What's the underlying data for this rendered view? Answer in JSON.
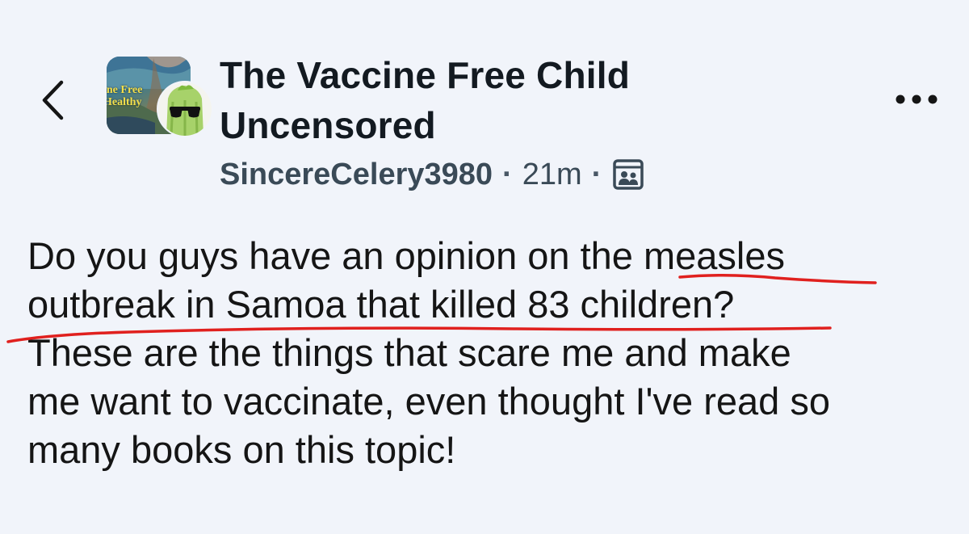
{
  "header": {
    "back_icon": "chevron-left-icon",
    "more_icon": "more-horizontal-icon",
    "group_avatar": {
      "text_line1": "ine Free",
      "text_line2": "Healthy"
    },
    "group_title_line1": "The Vaccine Free Child",
    "group_title_line2": "Uncensored",
    "username": "SincereCelery3980",
    "separator": "·",
    "time": "21m",
    "post_type_icon": "image-post-icon"
  },
  "post": {
    "line1": "Do you guys have an opinion on the measles",
    "line2": "outbreak in Samoa that killed 83 children?",
    "line3": "These are the things that scare me and make",
    "line4": "me want to vaccinate, even thought I've read so",
    "line5": "many books on this topic!"
  },
  "colors": {
    "background": "#f1f4fa",
    "text": "#151515",
    "meta": "#3a4a57",
    "annotation_underline": "#e0201e",
    "avatar_text": "#f4e04a"
  }
}
